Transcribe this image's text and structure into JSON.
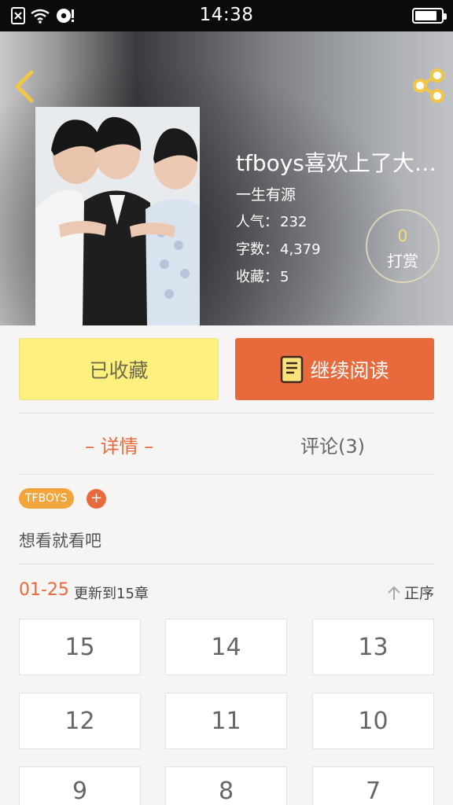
{
  "status_bar": {
    "time": "14:38",
    "battery_level": 0.85
  },
  "book": {
    "title": "tfboys喜欢上了大小…",
    "author": "一生有源",
    "stats": {
      "popularity_label": "人气：",
      "popularity": "232",
      "words_label": "字数：",
      "words": "4,379",
      "favorites_label": "收藏：",
      "favorites": "5"
    },
    "tip": {
      "count": "0",
      "label": "打赏"
    }
  },
  "actions": {
    "favorite_label": "已收藏",
    "read_label": "继续阅读"
  },
  "tabs": {
    "detail": "– 详情 –",
    "comments": "评论(3)"
  },
  "tags": [
    "TFBOYS"
  ],
  "tag_add": "+",
  "description": "想看就看吧",
  "chapters": {
    "update_date": "01-25",
    "update_text": "更新到15章",
    "sort_label": "正序",
    "items": [
      "15",
      "14",
      "13",
      "12",
      "11",
      "10",
      "9",
      "8",
      "7"
    ]
  },
  "colors": {
    "accent": "#e8693c",
    "favorite_bg": "#fdf07d",
    "tag_bg": "#f2a53b",
    "tip_count": "#f3de78"
  },
  "icons": [
    "back-icon",
    "share-icon",
    "book-icon",
    "sort-arrow-icon",
    "close-box-icon",
    "wifi-icon",
    "sync-icon",
    "battery-icon"
  ]
}
